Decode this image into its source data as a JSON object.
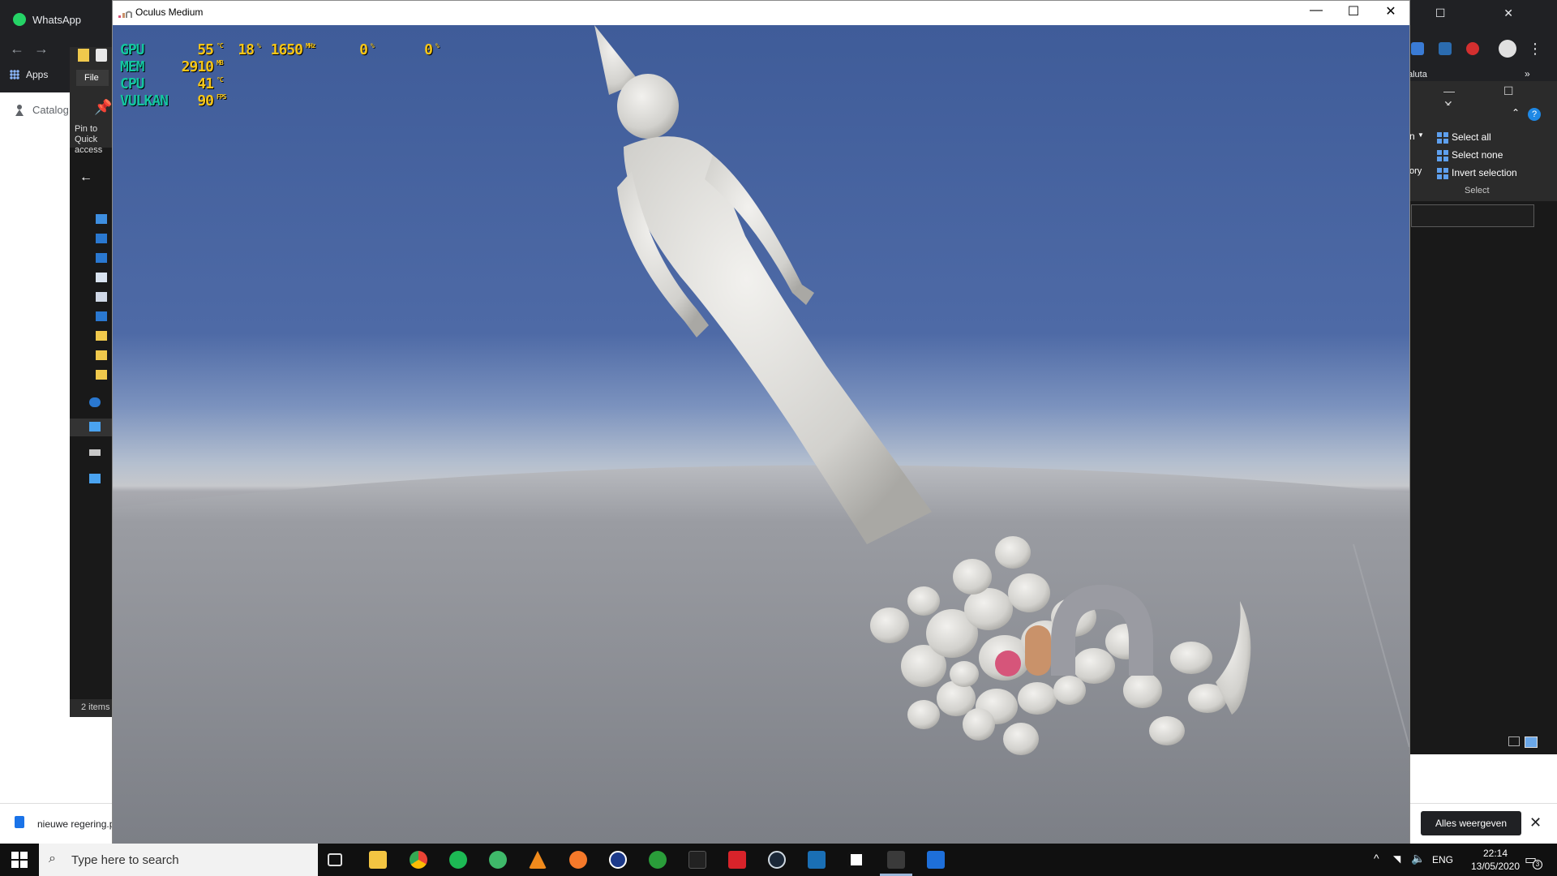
{
  "chrome": {
    "app_title": "WhatsApp",
    "bookmark_apps": "Apps",
    "catalog_tab": "Catalog",
    "bookmark_partial": "aluta",
    "bookmark_more": "»"
  },
  "explorer_left": {
    "file_tab": "File",
    "pin_text": "Pin to Quick access",
    "status": "2 items"
  },
  "explorer_right": {
    "partial_n": "n",
    "partial_ory": "ory",
    "select_all": "Select all",
    "select_none": "Select none",
    "invert_selection": "Invert selection",
    "select_group": "Select"
  },
  "oculus": {
    "window_title": "Oculus Medium",
    "stats": [
      {
        "label": "GPU",
        "value": "55",
        "unit": "°C"
      },
      {
        "label": "MEM",
        "value": "2910",
        "unit": "MB"
      },
      {
        "label": "CPU",
        "value": "41",
        "unit": "°C"
      },
      {
        "label": "VULKAN",
        "value": "90",
        "unit": "FPS"
      }
    ],
    "gpu_extra": [
      {
        "value": "18",
        "unit": "%"
      },
      {
        "value": "1650",
        "unit": "MHz"
      },
      {
        "value": "0",
        "unit": "%"
      },
      {
        "value": "0",
        "unit": "%"
      }
    ],
    "brand_colors": {
      "dot": "#d6557a",
      "bar": "#c9926a",
      "arch": "#9a9ba2"
    }
  },
  "download_bar": {
    "file_name": "nieuwe regering.p",
    "show_all": "Alles weergeven"
  },
  "taskbar": {
    "search_placeholder": "Type here to search",
    "language": "ENG",
    "time": "22:14",
    "date": "13/05/2020",
    "notification_count": "3",
    "apps": [
      "task-view",
      "file-explorer",
      "chrome",
      "spotify",
      "app-green",
      "vlc",
      "blender",
      "cinema4d",
      "xbox",
      "app-dark",
      "app-red",
      "steam",
      "app-blue",
      "oculus",
      "oculus-medium",
      "photos"
    ]
  },
  "icons": {
    "minimize": "—",
    "maximize": "☐",
    "close": "✕",
    "back": "←",
    "forward": "→"
  }
}
